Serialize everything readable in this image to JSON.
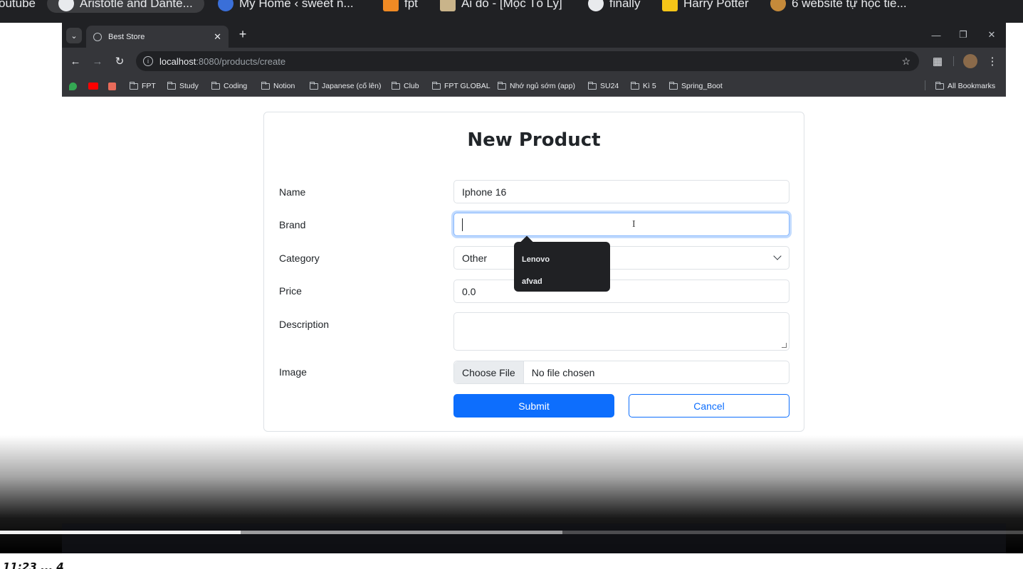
{
  "outer_bookmarks": [
    {
      "label": "outube",
      "icon": "youtube-icon"
    },
    {
      "label": "Aristotle and Dante...",
      "icon": "avatar-icon"
    },
    {
      "label": "My Home ‹ sweet n...",
      "icon": "wordpress-icon"
    },
    {
      "label": "fpt",
      "icon": "fpt-icon"
    },
    {
      "label": "Ai đó - [Mộc Tố Ly]",
      "icon": "image-icon"
    },
    {
      "label": "finally",
      "icon": "avatar-icon"
    },
    {
      "label": "Harry Potter",
      "icon": "folder-icon"
    },
    {
      "label": "6 website tự học tiế...",
      "icon": "site-icon"
    }
  ],
  "browser": {
    "tab_title": "Best Store",
    "url_host": "localhost",
    "url_path": ":8080/products/create",
    "bookmarks": [
      "FPT",
      "Study",
      "Coding",
      "Notion",
      "Japanese (cố lên)",
      "Club",
      "FPT GLOBAL",
      "Nhớ ngủ sớm (app)",
      "SU24",
      "Kì 5",
      "Spring_Boot"
    ],
    "all_bookmarks": "All Bookmarks"
  },
  "form": {
    "title": "New Product",
    "labels": {
      "name": "Name",
      "brand": "Brand",
      "category": "Category",
      "price": "Price",
      "description": "Description",
      "image": "Image"
    },
    "values": {
      "name": "Iphone 16",
      "brand": "",
      "category": "Other",
      "price": "0.0",
      "description": ""
    },
    "file": {
      "button": "Choose File",
      "status": "No file chosen"
    },
    "submit": "Submit",
    "cancel": "Cancel"
  },
  "autocomplete": [
    "Lenovo",
    "afvad"
  ],
  "video": {
    "played_fraction": 0.235,
    "buffered_fraction": 0.55,
    "time_label": "11:23 ... 4"
  },
  "colors": {
    "primary": "#0d6efd",
    "focus_border": "#86b7fe",
    "chrome_dark": "#35363a"
  }
}
